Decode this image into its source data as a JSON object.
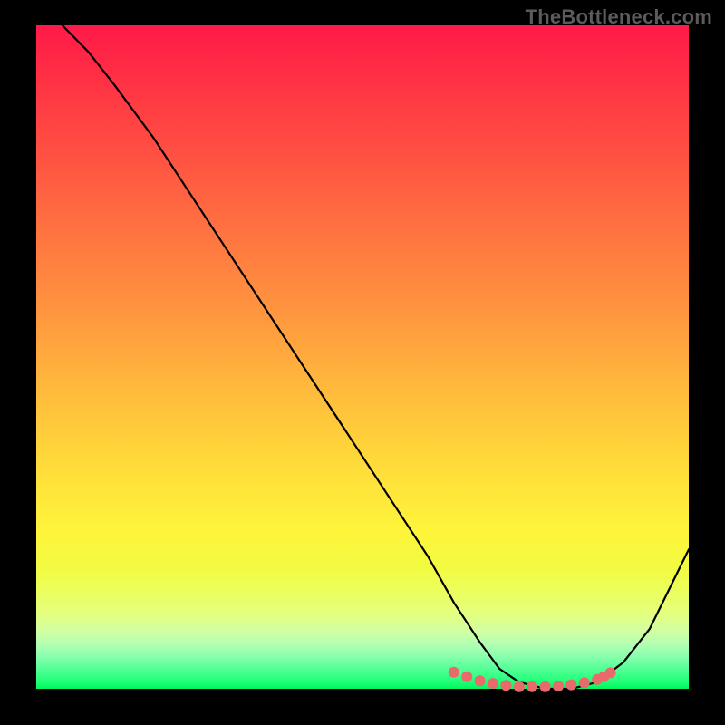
{
  "watermark": "TheBottleneck.com",
  "chart_data": {
    "type": "line",
    "title": "",
    "xlabel": "",
    "ylabel": "",
    "xlim": [
      0,
      100
    ],
    "ylim": [
      0,
      100
    ],
    "grid": false,
    "legend": false,
    "series": [
      {
        "name": "curve",
        "x": [
          4,
          8,
          12,
          18,
          24,
          30,
          36,
          42,
          48,
          54,
          60,
          64,
          68,
          71,
          74,
          78,
          82,
          86,
          90,
          94,
          100
        ],
        "y": [
          100,
          96,
          91,
          83,
          74,
          65,
          56,
          47,
          38,
          29,
          20,
          13,
          7,
          3,
          1,
          0,
          0,
          1,
          4,
          9,
          21
        ],
        "stroke": "#000000",
        "width": 2.2
      }
    ],
    "markers": {
      "name": "bottom-dots",
      "x": [
        64,
        66,
        68,
        70,
        72,
        74,
        76,
        78,
        80,
        82,
        84,
        86,
        87,
        88
      ],
      "y": [
        2.5,
        1.8,
        1.2,
        0.8,
        0.5,
        0.3,
        0.3,
        0.3,
        0.4,
        0.6,
        0.9,
        1.4,
        1.8,
        2.4
      ],
      "color": "#e96a6a",
      "radius": 6
    },
    "gradient_stops": [
      {
        "pos": 0.0,
        "color": "#ff1a48"
      },
      {
        "pos": 0.5,
        "color": "#ffb13d"
      },
      {
        "pos": 0.8,
        "color": "#f2fb42"
      },
      {
        "pos": 0.93,
        "color": "#b8ffb1"
      },
      {
        "pos": 1.0,
        "color": "#00f85e"
      }
    ]
  }
}
